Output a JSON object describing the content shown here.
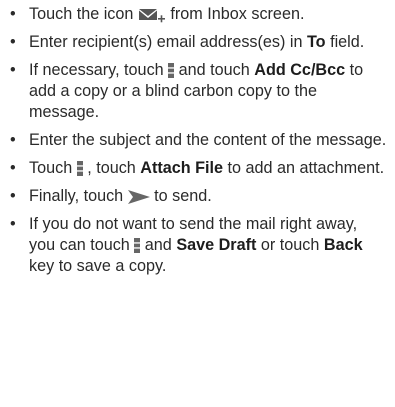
{
  "bullet": "•",
  "icons": {
    "compose": "compose-mail-icon",
    "menu": "menu-icon",
    "send": "send-icon"
  },
  "steps": [
    {
      "a": "Touch the icon ",
      "b": " from Inbox screen."
    },
    {
      "a": "Enter recipient(s) email address(es) in ",
      "bold": "To",
      "b": " field."
    },
    {
      "a": "If necessary, touch ",
      "b": " and touch ",
      "bold": "Add Cc/Bcc",
      "c": " to add a copy or a blind carbon copy to the message."
    },
    {
      "a": "Enter the subject and the content of the message."
    },
    {
      "a": "Touch ",
      "b": " , touch ",
      "bold": "Attach File",
      "c": " to add an attachment."
    },
    {
      "a": "Finally, touch ",
      "b": " to send."
    },
    {
      "a": "If you do not want to send the mail right away, you can touch ",
      "b": " and ",
      "bold": "Save Draft",
      "c": " or touch ",
      "bold2": "Back",
      "d": " key to save a copy."
    }
  ]
}
